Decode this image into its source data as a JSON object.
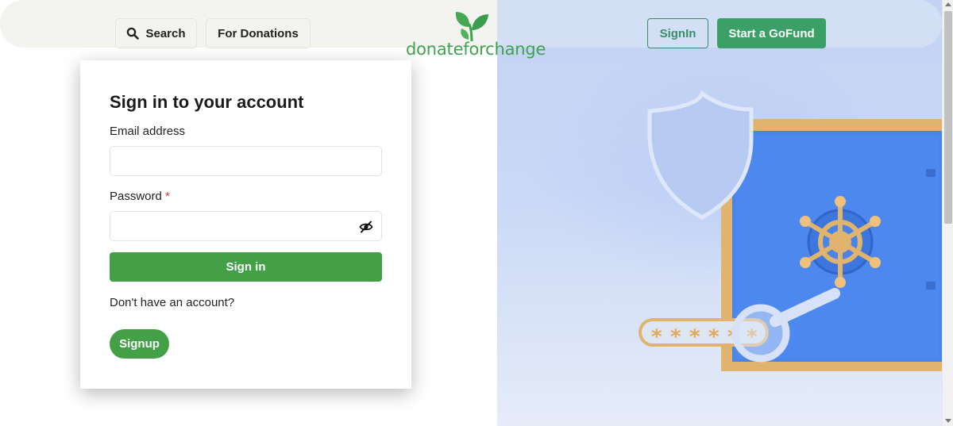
{
  "header": {
    "search_label": "Search",
    "donations_label": "For Donations",
    "logo_text": "donateforchange",
    "signin_label": "SignIn",
    "gofund_label": "Start a GoFund"
  },
  "login": {
    "title": "Sign in to your account",
    "email_label": "Email address",
    "email_value": "",
    "password_label": "Password",
    "password_required_mark": "*",
    "password_value": "",
    "submit_label": "Sign in",
    "no_account_text": "Don't have an account?",
    "signup_label": "Signup"
  },
  "icons": {
    "search": "search-icon",
    "eye_off": "eye-off-icon",
    "logo_leaves": "leaf-icon"
  },
  "colors": {
    "primary_green": "#43a047",
    "gofund_green": "#3ba065",
    "logo_green": "#3fa34d",
    "outline_green": "#3a8f6a",
    "illustration_bg": "#c3d3f3"
  }
}
